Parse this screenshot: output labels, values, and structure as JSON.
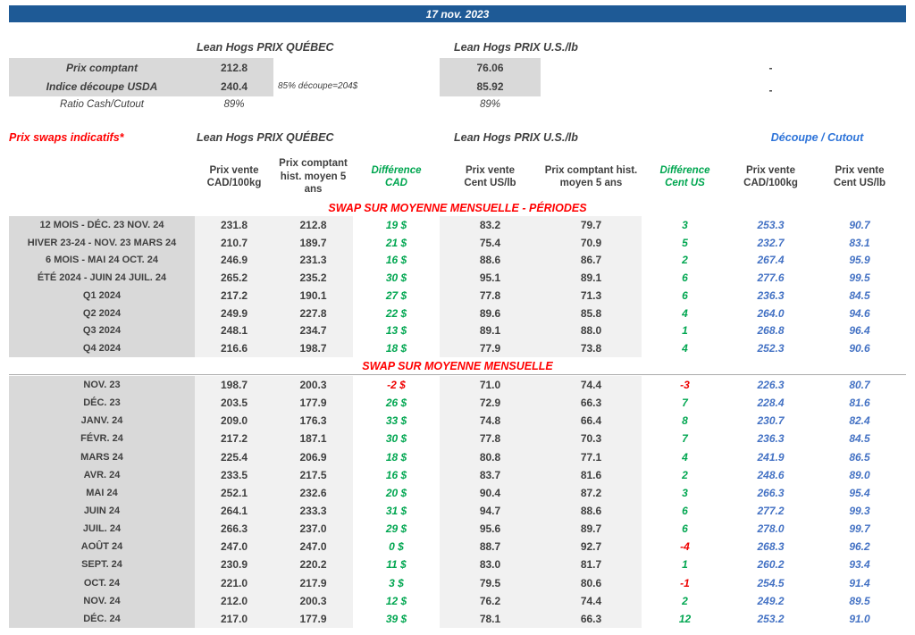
{
  "date_banner": "17 nov. 2023",
  "spot": {
    "qc_title": "Lean Hogs PRIX QUÉBEC",
    "us_title": "Lean Hogs PRIX U.S./lb",
    "row1": {
      "label": "Prix comptant",
      "qc": "212.8",
      "us": "76.06",
      "dash": "-"
    },
    "row2": {
      "label": "Indice découpe USDA",
      "qc": "240.4",
      "note": "85% découpe=204$",
      "us": "85.92",
      "dash": "-"
    },
    "row3": {
      "label": "Ratio Cash/Cutout",
      "qc": "89%",
      "us": "89%"
    }
  },
  "swaps": {
    "title": "Prix swaps indicatifs*",
    "qc_title": "Lean Hogs PRIX QUÉBEC",
    "us_title": "Lean Hogs PRIX U.S./lb",
    "cutout_title": "Découpe / Cutout",
    "col_headers": [
      "Prix vente\nCAD/100kg",
      "Prix comptant\nhist. moyen 5\nans",
      "Différence\nCAD",
      "Prix vente\nCent US/lb",
      "Prix comptant hist.\nmoyen 5 ans",
      "Différence\nCent US",
      "Prix vente\nCAD/100kg",
      "Prix vente\nCent US/lb"
    ],
    "periods_heading": "SWAP SUR MOYENNE MENSUELLE - PÉRIODES",
    "monthly_heading": "SWAP SUR MOYENNE MENSUELLE",
    "periods_rows": [
      {
        "label": "12 MOIS - DÉC. 23 NOV. 24",
        "cad_vente": "231.8",
        "cad_hist": "212.8",
        "diff_cad": 19,
        "us_vente": "83.2",
        "us_hist": "79.7",
        "diff_us": 3,
        "cutout_cad": "253.3",
        "cutout_us": "90.7"
      },
      {
        "label": "HIVER 23-24 -  NOV. 23 MARS 24",
        "cad_vente": "210.7",
        "cad_hist": "189.7",
        "diff_cad": 21,
        "us_vente": "75.4",
        "us_hist": "70.9",
        "diff_us": 5,
        "cutout_cad": "232.7",
        "cutout_us": "83.1"
      },
      {
        "label": "6 MOIS -  MAI 24 OCT. 24",
        "cad_vente": "246.9",
        "cad_hist": "231.3",
        "diff_cad": 16,
        "us_vente": "88.6",
        "us_hist": "86.7",
        "diff_us": 2,
        "cutout_cad": "267.4",
        "cutout_us": "95.9"
      },
      {
        "label": "ÉTÉ 2024 - JUIN 24 JUIL. 24",
        "cad_vente": "265.2",
        "cad_hist": "235.2",
        "diff_cad": 30,
        "us_vente": "95.1",
        "us_hist": "89.1",
        "diff_us": 6,
        "cutout_cad": "277.6",
        "cutout_us": "99.5"
      },
      {
        "label": "Q1 2024",
        "cad_vente": "217.2",
        "cad_hist": "190.1",
        "diff_cad": 27,
        "us_vente": "77.8",
        "us_hist": "71.3",
        "diff_us": 6,
        "cutout_cad": "236.3",
        "cutout_us": "84.5"
      },
      {
        "label": "Q2 2024",
        "cad_vente": "249.9",
        "cad_hist": "227.8",
        "diff_cad": 22,
        "us_vente": "89.6",
        "us_hist": "85.8",
        "diff_us": 4,
        "cutout_cad": "264.0",
        "cutout_us": "94.6"
      },
      {
        "label": "Q3 2024",
        "cad_vente": "248.1",
        "cad_hist": "234.7",
        "diff_cad": 13,
        "us_vente": "89.1",
        "us_hist": "88.0",
        "diff_us": 1,
        "cutout_cad": "268.8",
        "cutout_us": "96.4"
      },
      {
        "label": "Q4 2024",
        "cad_vente": "216.6",
        "cad_hist": "198.7",
        "diff_cad": 18,
        "us_vente": "77.9",
        "us_hist": "73.8",
        "diff_us": 4,
        "cutout_cad": "252.3",
        "cutout_us": "90.6"
      }
    ],
    "monthly_rows": [
      {
        "label": "NOV. 23",
        "cad_vente": "198.7",
        "cad_hist": "200.3",
        "diff_cad": -2,
        "us_vente": "71.0",
        "us_hist": "74.4",
        "diff_us": -3,
        "cutout_cad": "226.3",
        "cutout_us": "80.7"
      },
      {
        "label": "DÉC. 23",
        "cad_vente": "203.5",
        "cad_hist": "177.9",
        "diff_cad": 26,
        "us_vente": "72.9",
        "us_hist": "66.3",
        "diff_us": 7,
        "cutout_cad": "228.4",
        "cutout_us": "81.6"
      },
      {
        "label": "JANV. 24",
        "cad_vente": "209.0",
        "cad_hist": "176.3",
        "diff_cad": 33,
        "us_vente": "74.8",
        "us_hist": "66.4",
        "diff_us": 8,
        "cutout_cad": "230.7",
        "cutout_us": "82.4"
      },
      {
        "label": "FÉVR. 24",
        "cad_vente": "217.2",
        "cad_hist": "187.1",
        "diff_cad": 30,
        "us_vente": "77.8",
        "us_hist": "70.3",
        "diff_us": 7,
        "cutout_cad": "236.3",
        "cutout_us": "84.5"
      },
      {
        "label": "MARS 24",
        "cad_vente": "225.4",
        "cad_hist": "206.9",
        "diff_cad": 18,
        "us_vente": "80.8",
        "us_hist": "77.1",
        "diff_us": 4,
        "cutout_cad": "241.9",
        "cutout_us": "86.5"
      },
      {
        "label": "AVR. 24",
        "cad_vente": "233.5",
        "cad_hist": "217.5",
        "diff_cad": 16,
        "us_vente": "83.7",
        "us_hist": "81.6",
        "diff_us": 2,
        "cutout_cad": "248.6",
        "cutout_us": "89.0"
      },
      {
        "label": "MAI 24",
        "cad_vente": "252.1",
        "cad_hist": "232.6",
        "diff_cad": 20,
        "us_vente": "90.4",
        "us_hist": "87.2",
        "diff_us": 3,
        "cutout_cad": "266.3",
        "cutout_us": "95.4"
      },
      {
        "label": "JUIN 24",
        "cad_vente": "264.1",
        "cad_hist": "233.3",
        "diff_cad": 31,
        "us_vente": "94.7",
        "us_hist": "88.6",
        "diff_us": 6,
        "cutout_cad": "277.2",
        "cutout_us": "99.3"
      },
      {
        "label": "JUIL. 24",
        "cad_vente": "266.3",
        "cad_hist": "237.0",
        "diff_cad": 29,
        "us_vente": "95.6",
        "us_hist": "89.7",
        "diff_us": 6,
        "cutout_cad": "278.0",
        "cutout_us": "99.7"
      },
      {
        "label": "AOÛT 24",
        "cad_vente": "247.0",
        "cad_hist": "247.0",
        "diff_cad": 0,
        "us_vente": "88.7",
        "us_hist": "92.7",
        "diff_us": -4,
        "cutout_cad": "268.3",
        "cutout_us": "96.2"
      },
      {
        "label": "SEPT. 24",
        "cad_vente": "230.9",
        "cad_hist": "220.2",
        "diff_cad": 11,
        "us_vente": "83.0",
        "us_hist": "81.7",
        "diff_us": 1,
        "cutout_cad": "260.2",
        "cutout_us": "93.4"
      },
      {
        "label": "OCT. 24",
        "cad_vente": "221.0",
        "cad_hist": "217.9",
        "diff_cad": 3,
        "us_vente": "79.5",
        "us_hist": "80.6",
        "diff_us": -1,
        "cutout_cad": "254.5",
        "cutout_us": "91.4"
      },
      {
        "label": "NOV. 24",
        "cad_vente": "212.0",
        "cad_hist": "200.3",
        "diff_cad": 12,
        "us_vente": "76.2",
        "us_hist": "74.4",
        "diff_us": 2,
        "cutout_cad": "249.2",
        "cutout_us": "89.5"
      },
      {
        "label": "DÉC. 24",
        "cad_vente": "217.0",
        "cad_hist": "177.9",
        "diff_cad": 39,
        "us_vente": "78.1",
        "us_hist": "66.3",
        "diff_us": 12,
        "cutout_cad": "253.2",
        "cutout_us": "91.0"
      }
    ]
  },
  "colors": {
    "banner_blue": "#1e5a96",
    "label_gray": "#d9d9d9",
    "value_gray": "#f1f1f1",
    "green": "#00a650",
    "red": "#ff0000",
    "cutout_blue": "#4472c4"
  }
}
